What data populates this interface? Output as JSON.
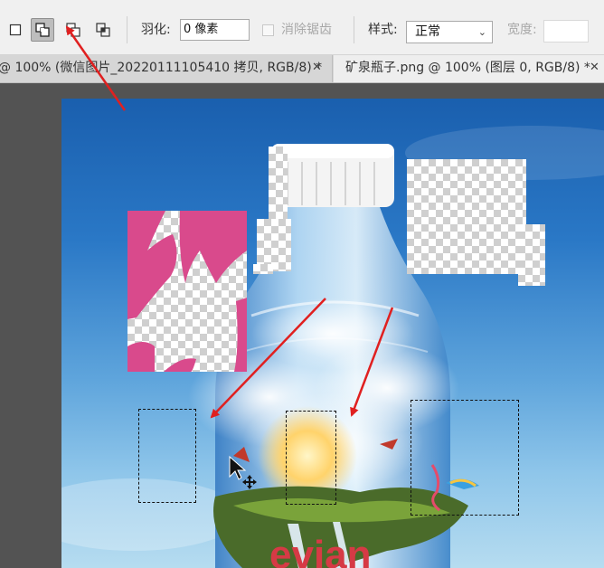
{
  "toolbar": {
    "selection_modes": [
      {
        "name": "new-selection"
      },
      {
        "name": "add-to-selection",
        "active": true
      },
      {
        "name": "subtract-from-selection"
      },
      {
        "name": "intersect-with-selection"
      }
    ],
    "feather_label": "羽化:",
    "feather_value": "0 像素",
    "antialias_label": "消除锯齿",
    "style_label": "样式:",
    "style_value": "正常",
    "width_label": "宽度:"
  },
  "tabs": [
    {
      "label": "@ 100% (微信图片_20220111105410 拷贝, RGB/8) *",
      "active": false
    },
    {
      "label": "矿泉瓶子.png @ 100% (图层 0, RGB/8) *",
      "active": true
    }
  ],
  "canvas": {
    "brand_text": "evian"
  },
  "colors": {
    "annotation_arrow": "#e02020",
    "active_tab": "#eeeeee",
    "inactive_tab": "#d6d6d6",
    "workspace": "#535353"
  }
}
